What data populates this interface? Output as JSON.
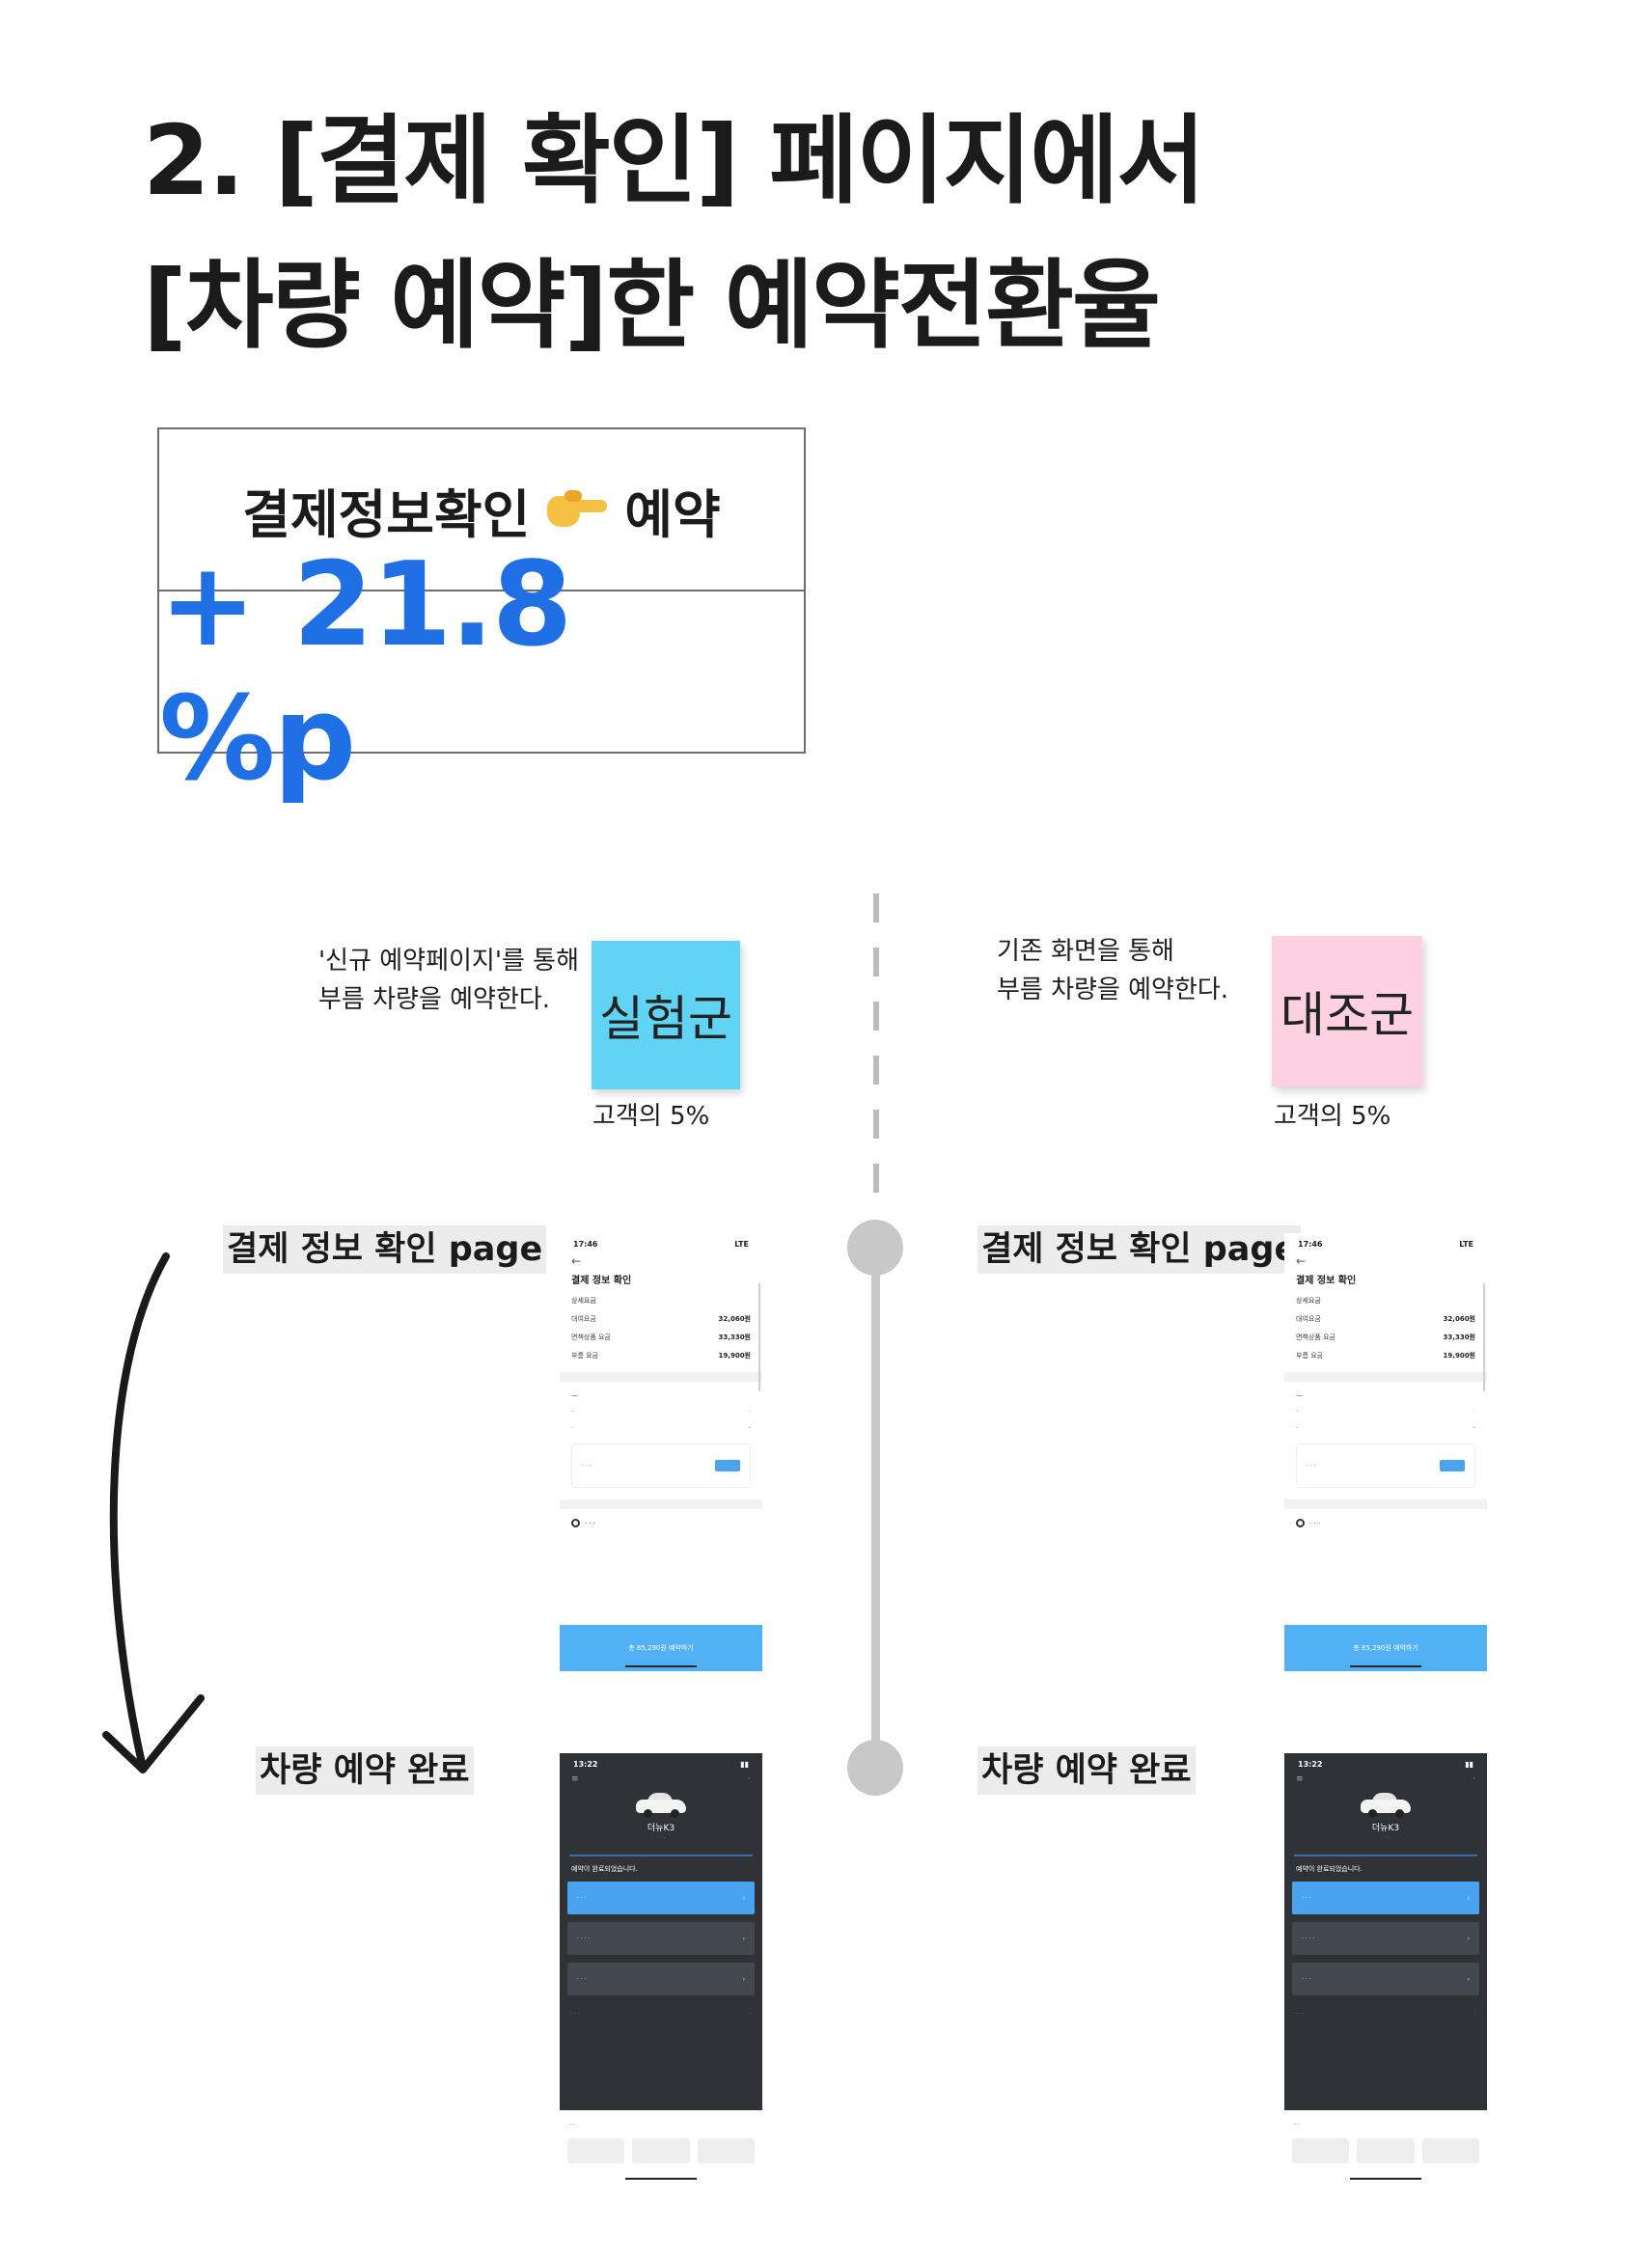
{
  "title": {
    "line1": "2. [결제 확인] 페이지에서",
    "line2": "[차량 예약]한 예약전환율"
  },
  "metric": {
    "from": "결제정보확인",
    "to": "예약",
    "value": "+ 21.8 %p",
    "accent_color": "#1f6fe5",
    "icon": "pointing-right-hand"
  },
  "experiment": {
    "description_line1": "'신규 예약페이지'를 통해",
    "description_line2": "부름 차량을 예약한다.",
    "group_label": "실험군",
    "share": "고객의 5%",
    "color": "#61d4f6"
  },
  "control": {
    "description_line1": "기존 화면을 통해",
    "description_line2": "부름 차량을 예약한다.",
    "group_label": "대조군",
    "share": "고객의 5%",
    "color": "#fdd1e2"
  },
  "steps": {
    "payment": "결제 정보 확인 page",
    "completed": "차량 예약 완료"
  },
  "payment_screen": {
    "time": "17:46",
    "carrier": "LTE",
    "title": "결제 정보 확인",
    "section": "상세요금",
    "rows": [
      {
        "label": "대여요금",
        "value": "32,060원"
      },
      {
        "label": "면책상품 요금",
        "value": "33,330원"
      },
      {
        "label": "부름 요금",
        "value": "19,900원"
      }
    ],
    "cta": "총 85,290원 예약하기"
  },
  "done_screen": {
    "time": "13:22",
    "car": "더뉴K3",
    "message": "예약이 완료되었습니다."
  }
}
